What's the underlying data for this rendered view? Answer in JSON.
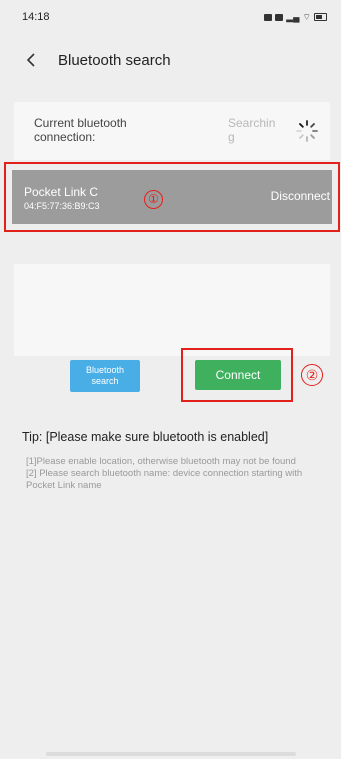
{
  "status_bar": {
    "time": "14:18"
  },
  "header": {
    "back_icon": "chevron-left-icon",
    "title": "Bluetooth search"
  },
  "current_connection": {
    "label": "Current bluetooth connection:",
    "status": "Searching",
    "spinner_icon": "loading-spinner-icon"
  },
  "device": {
    "name": "Pocket Link C",
    "mac": "04:F5:77:36:B9:C3",
    "marker": "①",
    "action_label": "Disconnect"
  },
  "actions": {
    "search_label": "Bluetooth search",
    "connect_label": "Connect",
    "connect_marker": "②"
  },
  "tip": {
    "title": "Tip: [Please make sure bluetooth is enabled]",
    "lines": [
      "[1]Please enable location, otherwise bluetooth may not be found",
      "[2] Please search bluetooth name: device connection starting with Pocket Link name"
    ]
  },
  "colors": {
    "accent_red": "#e3211b",
    "search_button": "#4aaee6",
    "connect_button": "#3fb05e",
    "device_row_bg": "#9c9c9c"
  }
}
